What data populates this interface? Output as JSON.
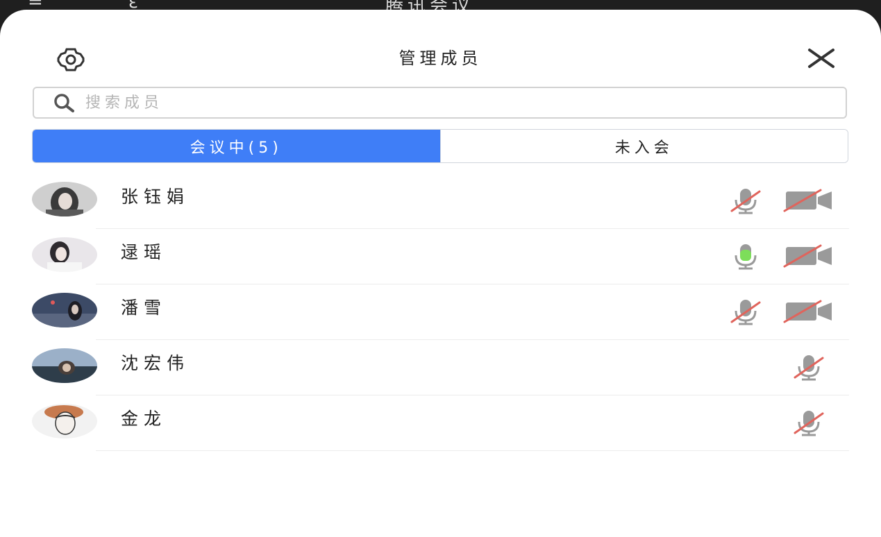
{
  "status_bar": {
    "app_title": "腾讯会议",
    "left_glyph_1": "≚",
    "left_glyph_2": "ε"
  },
  "header": {
    "title": "管理成员",
    "settings_icon": "gear-icon",
    "close_icon": "close-icon"
  },
  "search": {
    "placeholder": "搜索成员",
    "value": ""
  },
  "tabs": [
    {
      "label": "会议中(5)",
      "active": true
    },
    {
      "label": "未入会",
      "active": false
    }
  ],
  "members": [
    {
      "name": "张钰娟",
      "mic": "muted",
      "camera": "off",
      "show_camera": true
    },
    {
      "name": "逯瑶",
      "mic": "active",
      "camera": "off",
      "show_camera": true
    },
    {
      "name": "潘雪",
      "mic": "muted",
      "camera": "off",
      "show_camera": true
    },
    {
      "name": "沈宏伟",
      "mic": "muted",
      "show_camera": false
    },
    {
      "name": "金龙",
      "mic": "muted",
      "show_camera": false
    }
  ],
  "colors": {
    "accent": "#3f7ef7",
    "mic_active": "#7dde5a",
    "muted_slash": "#e0645c",
    "icon_gray": "#9a9a9a"
  }
}
